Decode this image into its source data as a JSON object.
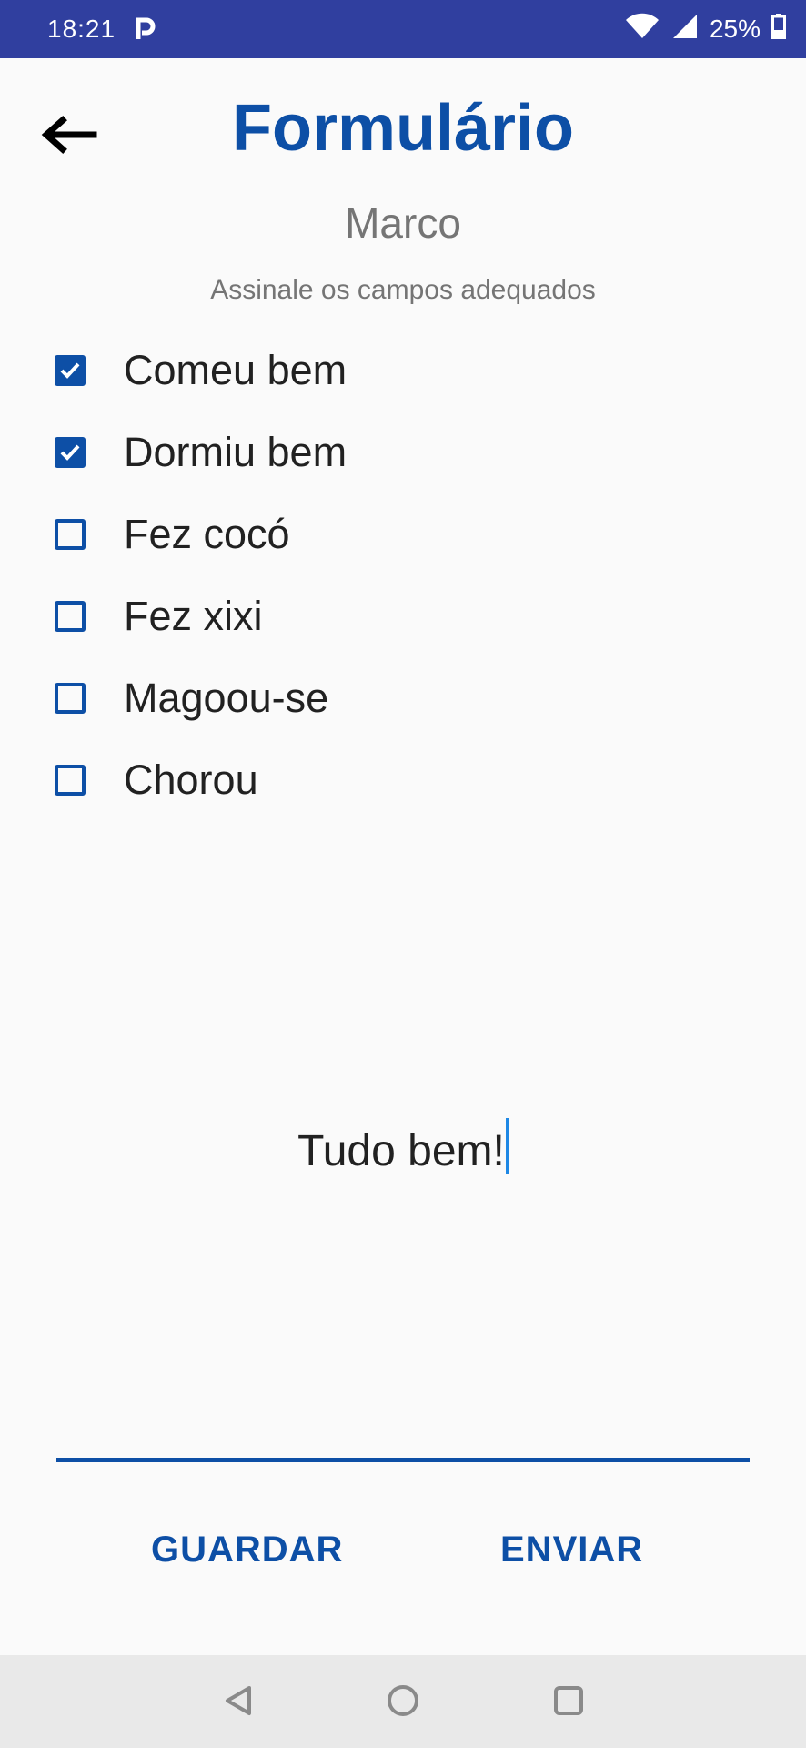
{
  "status_bar": {
    "time": "18:21",
    "notification_icon": "p-icon",
    "battery": "25%",
    "icons": [
      "wifi-icon",
      "signal-icon",
      "battery-icon"
    ]
  },
  "header": {
    "title": "Formulário",
    "back_icon": "arrow-left-icon"
  },
  "person": {
    "name": "Marco"
  },
  "instructions": "Assinale os campos adequados",
  "checklist": [
    {
      "label": "Comeu bem",
      "checked": true
    },
    {
      "label": "Dormiu bem",
      "checked": true
    },
    {
      "label": "Fez cocó",
      "checked": false
    },
    {
      "label": "Fez xixi",
      "checked": false
    },
    {
      "label": "Magoou-se",
      "checked": false
    },
    {
      "label": "Chorou",
      "checked": false
    }
  ],
  "note": {
    "value": "Tudo bem!"
  },
  "actions": {
    "save_label": "GUARDAR",
    "send_label": "ENVIAR"
  },
  "colors": {
    "accent": "#0d4fa6",
    "status_bar": "#303f9f",
    "cursor": "#1e88e5"
  }
}
